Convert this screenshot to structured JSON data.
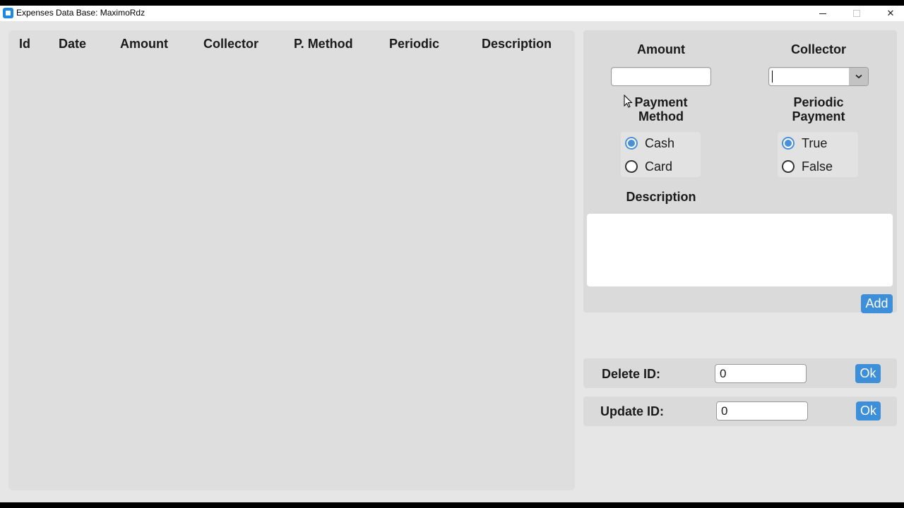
{
  "window": {
    "title": "Expenses Data Base: MaximoRdz",
    "controls": {
      "minimize": "–",
      "maximize": "□",
      "close": "✕"
    }
  },
  "table": {
    "columns": [
      "Id",
      "Date",
      "Amount",
      "Collector",
      "P. Method",
      "Periodic",
      "Description"
    ],
    "rows": []
  },
  "form": {
    "amount_label": "Amount",
    "amount_value": "",
    "collector_label": "Collector",
    "collector_value": "",
    "payment_method_label_line1": "Payment",
    "payment_method_label_line2": "Method",
    "payment_method_options": [
      {
        "label": "Cash",
        "checked": true
      },
      {
        "label": "Card",
        "checked": false
      }
    ],
    "periodic_label_line1": "Periodic",
    "periodic_label_line2": "Payment",
    "periodic_options": [
      {
        "label": "True",
        "checked": true
      },
      {
        "label": "False",
        "checked": false
      }
    ],
    "description_label": "Description",
    "description_value": "",
    "add_button": "Add"
  },
  "delete": {
    "label": "Delete ID:",
    "value": "0",
    "ok_button": "Ok"
  },
  "update": {
    "label": "Update ID:",
    "value": "0",
    "ok_button": "Ok"
  },
  "colors": {
    "accent": "#3d8fd9",
    "panel": "#dadada",
    "window_bg": "#e6e6e6",
    "app_icon": "#1e88e5"
  }
}
